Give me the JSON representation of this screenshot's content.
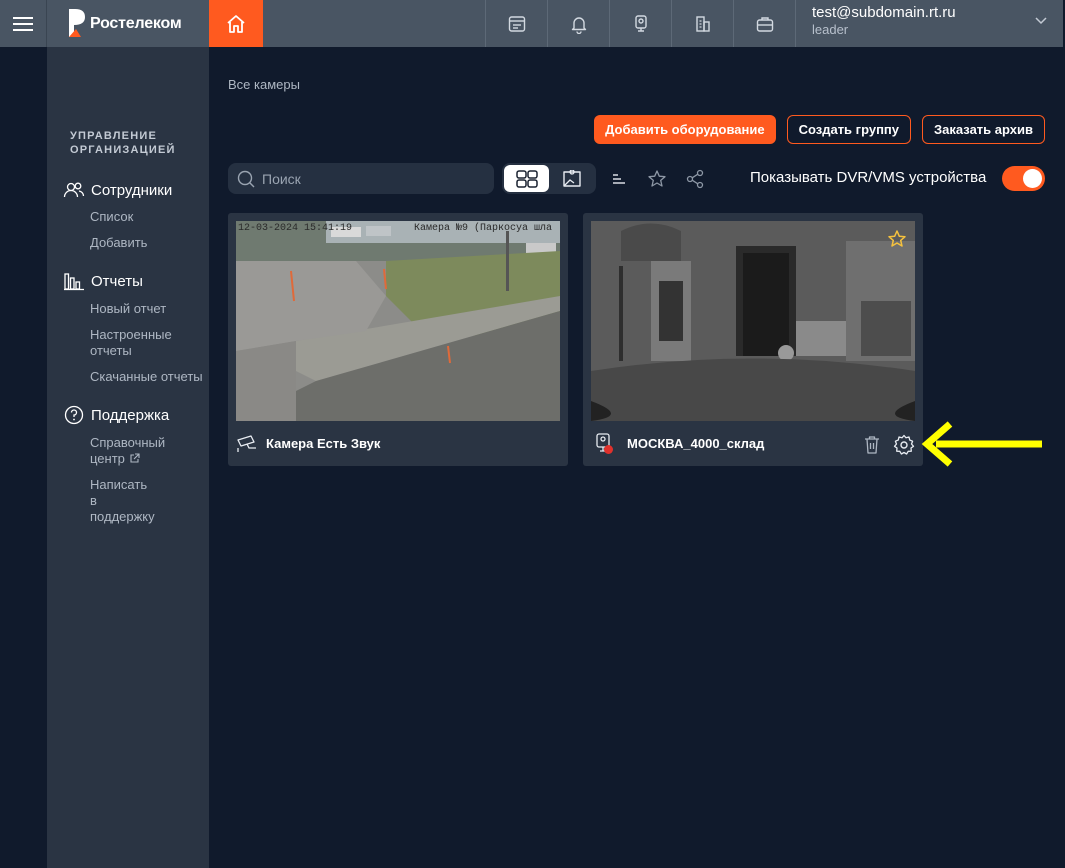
{
  "header": {
    "menu_icon": "hamburger-icon",
    "logo_text": "Ростелеком",
    "home_icon": "home-icon",
    "icons": [
      "calendar-icon",
      "bell-icon",
      "camera-icon",
      "building-icon",
      "briefcase-icon"
    ],
    "user": {
      "email": "test@subdomain.rt.ru",
      "role": "leader"
    },
    "accent": "#ff5a1f"
  },
  "sidebar": {
    "heading": "УПРАВЛЕНИЕ ОРГАНИЗАЦИЕЙ",
    "sections": [
      {
        "label": "Сотрудники",
        "icon": "users-icon",
        "links": [
          "Список",
          "Добавить"
        ]
      },
      {
        "label": "Отчеты",
        "icon": "bar-chart-icon",
        "links": [
          "Новый отчет",
          "Настроенные отчеты",
          "Скачанные отчеты"
        ]
      },
      {
        "label": "Поддержка",
        "icon": "help-circle-icon",
        "links": [
          "Справочный центр",
          "Написать в поддержку"
        ]
      }
    ]
  },
  "main": {
    "breadcrumb": "Все камеры",
    "buttons": {
      "add_equipment": "Добавить оборудование",
      "create_group": "Создать группу",
      "order_archive": "Заказать архив"
    },
    "search": {
      "placeholder": "Поиск",
      "value": ""
    },
    "dvr_toggle": {
      "label": "Показывать DVR/VMS устройства",
      "on": true
    },
    "cameras": [
      {
        "title": "Камера Есть Звук",
        "icon": "cctv-camera-icon",
        "overlay_time": "12-03-2024 15:41:19",
        "overlay_name": "Камера №9 (Паркосуа шла"
      },
      {
        "title": "МОСКВА_4000_склад",
        "icon": "webcam-icon",
        "favorite": true,
        "has_error_badge": true
      }
    ]
  }
}
